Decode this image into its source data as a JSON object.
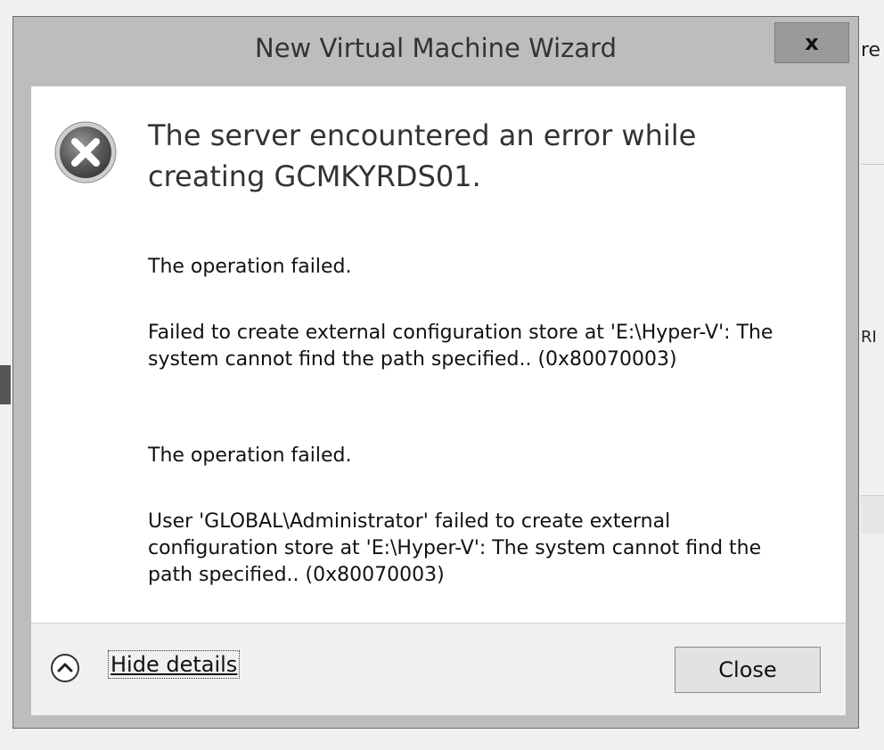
{
  "background": {
    "right_fragment_1": "re",
    "right_fragment_2": "RI"
  },
  "dialog": {
    "title": "New Virtual Machine Wizard",
    "close_glyph": "x",
    "heading": "The server encountered an error while creating GCMKYRDS01.",
    "messages": [
      "The operation failed.",
      "Failed to create external configuration store at 'E:\\Hyper-V': The system cannot find the path specified.. (0x80070003)",
      "The operation failed.",
      "User 'GLOBAL\\Administrator' failed to create external configuration store at 'E:\\Hyper-V': The system cannot find the path specified.. (0x80070003)"
    ],
    "icons": {
      "error": "error-x-icon",
      "toggle": "chevron-up-icon"
    },
    "footer": {
      "hide_details_label": "Hide details",
      "close_label": "Close"
    },
    "colors": {
      "frame": "#bdbdbd",
      "content_bg": "#ffffff",
      "footer_bg": "#f0f0f0"
    }
  }
}
